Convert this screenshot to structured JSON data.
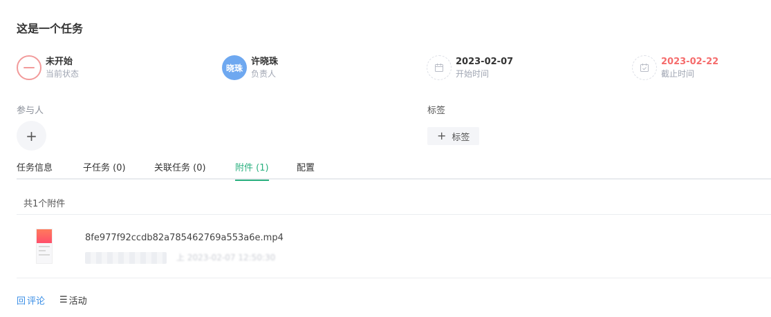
{
  "task": {
    "title": "这是一个任务"
  },
  "info": {
    "status": {
      "value": "未开始",
      "label": "当前状态"
    },
    "assignee": {
      "avatar_text": "晓珠",
      "name": "许晓珠",
      "label": "负责人"
    },
    "start": {
      "date": "2023-02-07",
      "label": "开始时间"
    },
    "due": {
      "date": "2023-02-22",
      "label": "截止时间"
    }
  },
  "participants": {
    "label": "参与人",
    "add_icon": "+"
  },
  "tags": {
    "label": "标签",
    "add_icon": "+",
    "add_label": "标签"
  },
  "tabs": [
    {
      "label": "任务信息"
    },
    {
      "label": "子任务 (0)"
    },
    {
      "label": "关联任务 (0)"
    },
    {
      "label": "附件 (1)",
      "active": true
    },
    {
      "label": "配置"
    }
  ],
  "attachments": {
    "count_text": "共1个附件",
    "items": [
      {
        "file_name": "8fe977f92ccdb82a785462769a553a6e.mp4",
        "meta_blurred": "上 2023-02-07 12:50:30"
      }
    ]
  },
  "bottom": {
    "comment": {
      "icon": "回",
      "label": "评论"
    },
    "activity": {
      "icon": "☰",
      "label": "活动"
    }
  },
  "colors": {
    "accent_green": "#2ab07f",
    "due_red": "#f56c6c",
    "avatar_blue": "#6ea8f0",
    "link_blue": "#3a8ee6"
  }
}
